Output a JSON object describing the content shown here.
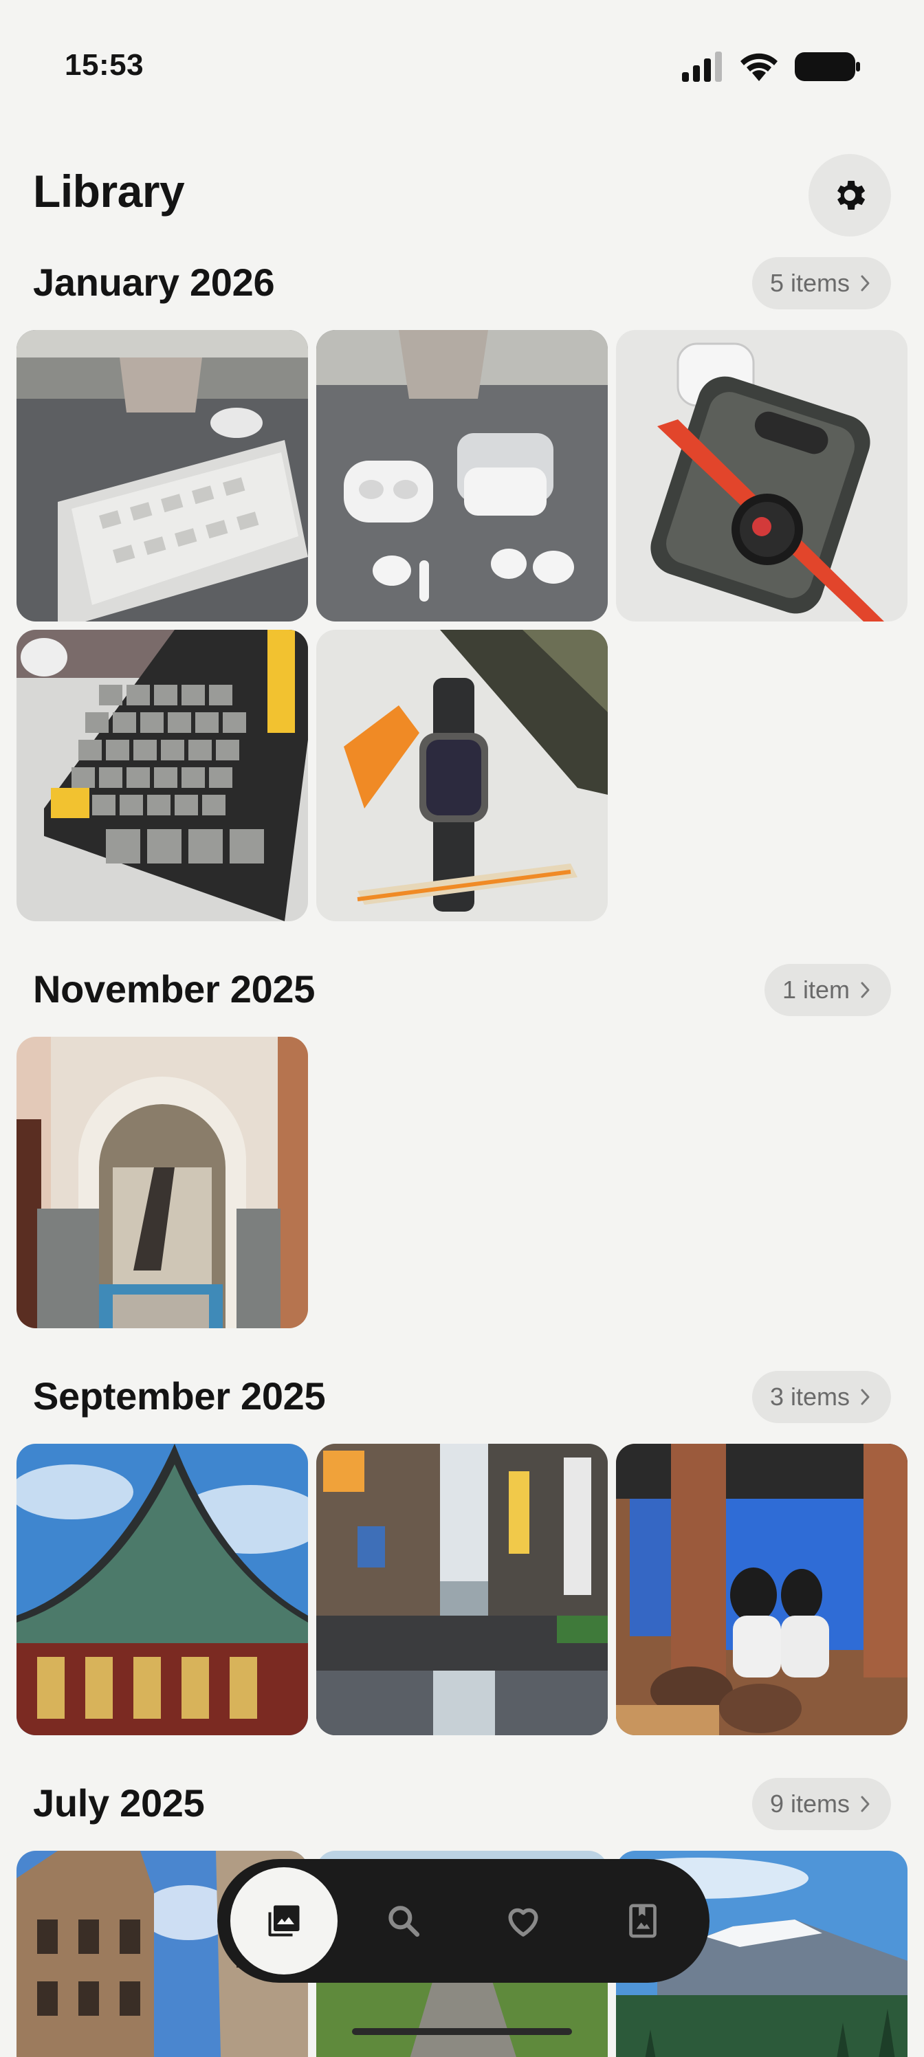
{
  "status_bar": {
    "time": "15:53"
  },
  "header": {
    "title": "Library"
  },
  "sections": [
    {
      "title": "January 2026",
      "count_label": "5 items"
    },
    {
      "title": "November 2025",
      "count_label": "1 item"
    },
    {
      "title": "September 2025",
      "count_label": "3 items"
    },
    {
      "title": "July 2025",
      "count_label": "9 items"
    }
  ],
  "photos": [
    "photo-keyboard-earbuds",
    "photo-earbuds-cases",
    "photo-phone-watch",
    "photo-mechanical-keyboard",
    "photo-watch-bands",
    "photo-moroccan-doorway",
    "photo-korean-palace-roof",
    "photo-rainy-street",
    "photo-cafe-interior",
    "photo-old-building",
    "photo-forest-road",
    "photo-snowy-mountain"
  ],
  "nav": {
    "items": [
      "photos-icon",
      "search-icon",
      "heart-icon",
      "bookmark-photo-icon"
    ],
    "active": "photos-icon"
  },
  "colors": {
    "background": "#f4f4f2",
    "nav_bar": "#1b1b1b",
    "pill": "#e4e4e2"
  }
}
